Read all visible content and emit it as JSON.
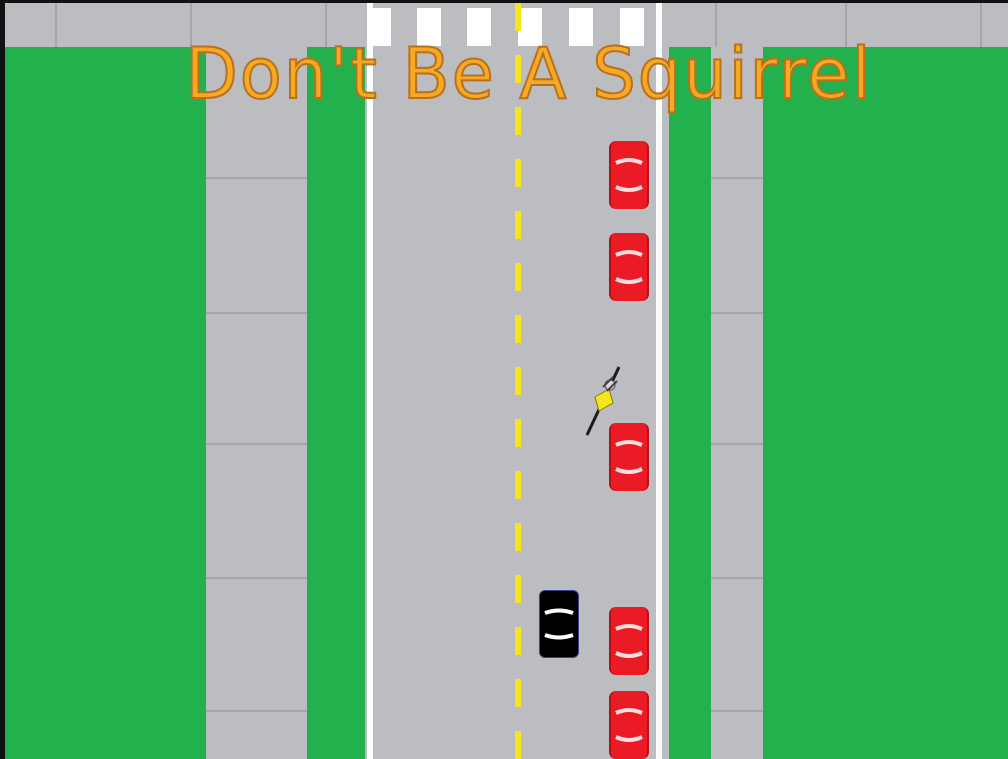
{
  "game": {
    "title": "Don't Be A Squirrel"
  },
  "scene": {
    "grass_color": "#23b14d",
    "pavement_color": "#bcbdc0",
    "lane_edge_color": "#ffffff",
    "center_line_color": "#f5e51d",
    "center_line_style": "dashed"
  },
  "entities": {
    "player": {
      "type": "cyclist",
      "jersey_color": "#f5e51d"
    },
    "parked_cars": {
      "count": 5,
      "color": "#ea1b24"
    },
    "moving_car": {
      "count": 1,
      "color": "#000000"
    }
  }
}
